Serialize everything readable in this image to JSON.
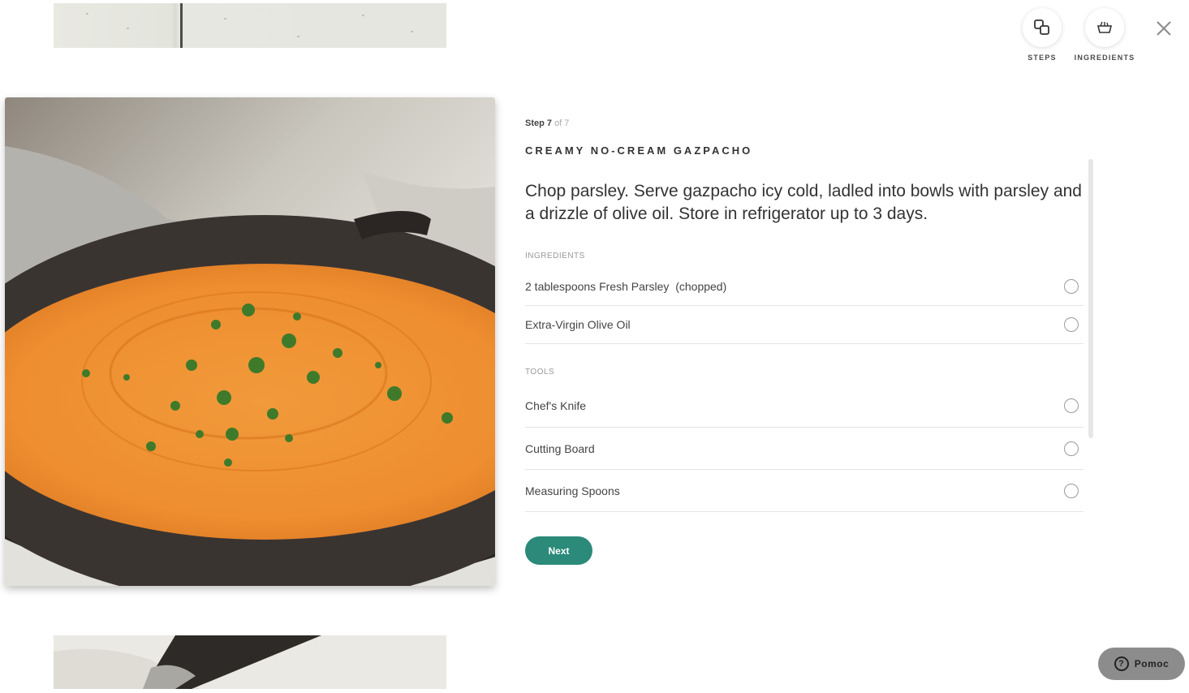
{
  "header": {
    "steps_label": "STEPS",
    "ingredients_label": "INGREDIENTS",
    "close_icon": "close-icon",
    "steps_icon": "steps-icon",
    "ingredients_icon": "ingredients-bowl-icon"
  },
  "step": {
    "prefix": "Step 7",
    "suffix": "of 7",
    "recipe_title": "CREAMY NO-CREAM GAZPACHO",
    "instruction": "Chop parsley. Serve gazpacho icy cold, ladled into bowls with parsley and a drizzle of olive oil. Store in refrigerator up to 3 days."
  },
  "ingredients": {
    "label": "INGREDIENTS",
    "items": [
      {
        "text": "2 tablespoons Fresh Parsley  (chopped)"
      },
      {
        "text": "Extra-Virgin Olive Oil"
      }
    ]
  },
  "tools": {
    "label": "TOOLS",
    "items": [
      {
        "text": "Chef's Knife"
      },
      {
        "text": "Cutting Board"
      },
      {
        "text": "Measuring Spoons"
      }
    ]
  },
  "actions": {
    "next_label": "Next"
  },
  "help": {
    "label": "Pomoc",
    "icon": "question-icon"
  },
  "colors": {
    "accent": "#2b8a7a",
    "help_bg": "#8c8c8c"
  }
}
